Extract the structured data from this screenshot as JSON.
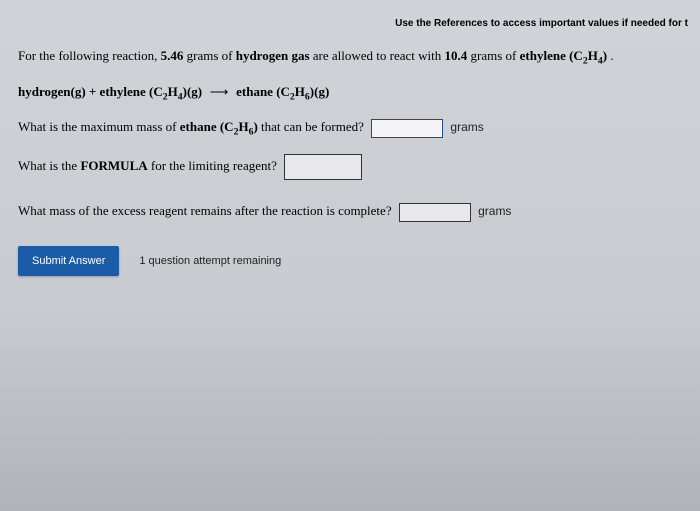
{
  "header": {
    "references": "Use the References to access important values if needed for t"
  },
  "intro": {
    "pre": "For the following reaction, ",
    "mass_h2": "5.46",
    "mid1": " grams of ",
    "reagent1": "hydrogen gas",
    "mid2": " are allowed to react with ",
    "mass_c2h4": "10.4",
    "mid3": " grams of ",
    "reagent2": "ethylene (C",
    "sub24a": "2",
    "reagent2b": "H",
    "sub24b": "4",
    "reagent2c": ")",
    "tail": " ."
  },
  "equation": {
    "lhs1": "hydrogen(g) + ethylene (C",
    "s1": "2",
    "lhs2": "H",
    "s2": "4",
    "lhs3": ")(g)",
    "rhs1": "ethane (C",
    "s3": "2",
    "rhs2": "H",
    "s4": "6",
    "rhs3": ")(g)"
  },
  "q1": {
    "pre": "What is the maximum mass of ",
    "b1": "ethane (C",
    "s1": "2",
    "b2": "H",
    "s2": "6",
    "b3": ")",
    "post": " that can be formed?",
    "unit": "grams"
  },
  "q2": {
    "pre": "What is the ",
    "b": "FORMULA",
    "post": " for the limiting reagent?"
  },
  "q3": {
    "text": "What mass of the excess reagent remains after the reaction is complete?",
    "unit": "grams"
  },
  "submit": {
    "label": "Submit Answer",
    "attempts": "1 question attempt remaining"
  }
}
